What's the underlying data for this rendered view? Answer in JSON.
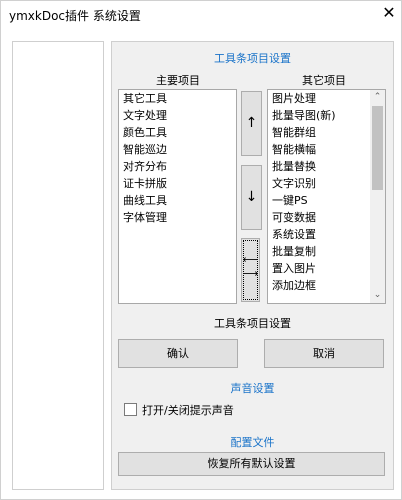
{
  "window": {
    "title": "ymxkDoc插件 系统设置"
  },
  "toolbar_section": {
    "title": "工具条项目设置",
    "main_header": "主要项目",
    "other_header": "其它项目",
    "main_items": [
      "其它工具",
      "文字处理",
      "颜色工具",
      "智能巡边",
      "对齐分布",
      "证卡拼版",
      "曲线工具",
      "字体管理"
    ],
    "other_items": [
      "图片处理",
      "批量导图(新)",
      "智能群组",
      "智能横幅",
      "批量替换",
      "文字识别",
      "一键PS",
      "可变数据",
      "系统设置",
      "批量复制",
      "置入图片",
      "添加边框"
    ],
    "up_glyph": "↑",
    "down_glyph": "↓",
    "swap_glyph": "⟵\n⟶",
    "footer_label": "工具条项目设置",
    "confirm_label": "确认",
    "cancel_label": "取消"
  },
  "sound_section": {
    "title": "声音设置",
    "toggle_label": "打开/关闭提示声音",
    "toggle_checked": false
  },
  "config_section": {
    "title": "配置文件",
    "restore_label": "恢复所有默认设置"
  },
  "colors": {
    "section_title": "#1a73c9"
  },
  "icons": {
    "close": "close-icon",
    "scroll_up": "chevron-up-icon",
    "scroll_down": "chevron-down-icon"
  }
}
